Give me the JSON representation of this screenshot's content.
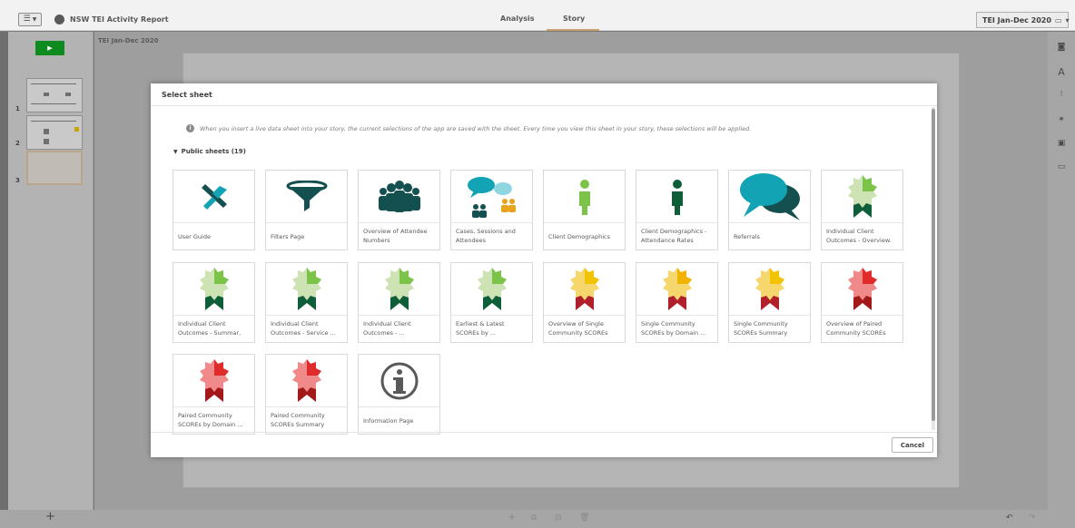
{
  "topbar": {
    "menu_icon": "hamburger-icon",
    "app_title": "NSW TEI Activity Report",
    "tabs": [
      {
        "label": "Analysis"
      },
      {
        "label": "Story"
      }
    ],
    "selection": "TEI Jan-Dec 2020",
    "accent_color": "#c8a16c"
  },
  "left_panel": {
    "play_icon": "play-icon",
    "slide_numbers": [
      "1",
      "2",
      "3"
    ],
    "add_label": "+"
  },
  "canvas": {
    "story_title": "TEI Jan-Dec 2020"
  },
  "modal": {
    "title": "Select sheet",
    "info_text": "When you insert a live data sheet into your story, the current selections of the app are saved with the sheet. Every time you view this sheet in your story, these selections will be applied.",
    "section_label": "Public sheets (19)",
    "cancel_label": "Cancel",
    "sheets": [
      {
        "label": "User Guide",
        "icon": "tools-icon",
        "color": "#1b5e5e"
      },
      {
        "label": "Filters Page",
        "icon": "funnel-icon",
        "color": "#1b5e5e"
      },
      {
        "label": "Overview of Attendee Numbers",
        "icon": "group-icon",
        "color": "#1b5e5e"
      },
      {
        "label": "Cases, Sessions and Attendees",
        "icon": "chat-people-icon",
        "color": "#12a3b5"
      },
      {
        "label": "Client Demographics",
        "icon": "person-icon",
        "color": "#7cc34a"
      },
      {
        "label": "Client Demographics - Attendance Rates",
        "icon": "person-icon",
        "color": "#0f5e3a"
      },
      {
        "label": "Referrals",
        "icon": "speech-bubbles-icon",
        "color": "#12a3b5"
      },
      {
        "label": "Individual Client Outcomes - Overview.",
        "icon": "ribbon-icon",
        "color": "#7cc34a"
      },
      {
        "label": "Individual Client Outcomes - Summar,",
        "icon": "ribbon-icon",
        "color": "#7cc34a"
      },
      {
        "label": "Individual Client Outcomes - Service ...",
        "icon": "ribbon-icon",
        "color": "#7cc34a"
      },
      {
        "label": "Individual Client Outcomes - ...",
        "icon": "ribbon-icon",
        "color": "#7cc34a"
      },
      {
        "label": "Earliest & Latest SCOREs by ...",
        "icon": "ribbon-icon",
        "color": "#7cc34a"
      },
      {
        "label": "Overview of Single Community SCOREs",
        "icon": "ribbon-icon",
        "color": "#f2c300"
      },
      {
        "label": "Single Community SCOREs by Domain ...",
        "icon": "ribbon-icon",
        "color": "#f2b300"
      },
      {
        "label": "Single Community SCOREs Summary",
        "icon": "ribbon-icon",
        "color": "#f2c300"
      },
      {
        "label": "Overview of Paired Community SCOREs",
        "icon": "ribbon-icon",
        "color": "#e02b2b"
      },
      {
        "label": "Paired Community SCOREs by Domain ...",
        "icon": "ribbon-icon",
        "color": "#e02b2b"
      },
      {
        "label": "Paired Community SCOREs Summary",
        "icon": "ribbon-icon",
        "color": "#e02b2b"
      },
      {
        "label": "Information Page",
        "icon": "info-icon",
        "color": "#595959"
      }
    ]
  }
}
